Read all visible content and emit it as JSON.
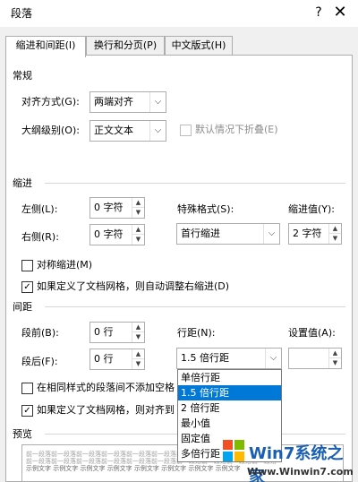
{
  "window": {
    "title": "段落",
    "help": "?",
    "close": "✕"
  },
  "tabs": [
    {
      "label": "缩进和间距(I)"
    },
    {
      "label": "换行和分页(P)"
    },
    {
      "label": "中文版式(H)"
    }
  ],
  "general": {
    "heading": "常规",
    "alignment_label": "对齐方式(G):",
    "alignment_value": "两端对齐",
    "outline_label": "大纲级别(O):",
    "outline_value": "正文文本",
    "collapse_label": "默认情况下折叠(E)"
  },
  "indent": {
    "heading": "缩进",
    "left_label": "左侧(L):",
    "left_value": "0 字符",
    "right_label": "右侧(R):",
    "right_value": "0 字符",
    "special_label": "特殊格式(S):",
    "special_value": "首行缩进",
    "by_label": "缩进值(Y):",
    "by_value": "2 字符",
    "mirror_label": "对称缩进(M)",
    "auto_adjust_label": "如果定义了文档网格，则自动调整右缩进(D)"
  },
  "spacing": {
    "heading": "间距",
    "before_label": "段前(B):",
    "before_value": "0 行",
    "after_label": "段后(F):",
    "after_value": "0 行",
    "line_label": "行距(N):",
    "line_value": "1.5 倍行距",
    "at_label": "设置值(A):",
    "no_space_label": "在相同样式的段落间不添加空格",
    "snap_label": "如果定义了文档网格，则对齐到"
  },
  "line_spacing_options": [
    "单倍行距",
    "1.5 倍行距",
    "2 倍行距",
    "最小值",
    "固定值",
    "多倍行距"
  ],
  "preview": {
    "heading": "预览",
    "line1": "前一段落前一段落前一段落前一段落前一段落前一段落前一段落前一段落前一段落前一段落",
    "line2": "前一段落前一段落前一段落前一段落前一段落前一段落前一段落前一段落前一段落前一段落",
    "line3": "示例文字 示例文字 示例文字 示例文字 示例文字 示例文字 示例文字 示例文字"
  },
  "watermark": {
    "logo": "Win7系统之家",
    "site": "Www.Winwin7.com"
  }
}
